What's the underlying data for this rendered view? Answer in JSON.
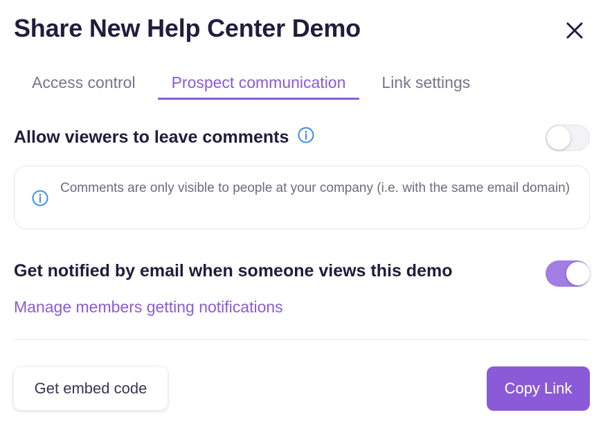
{
  "dialog": {
    "title": "Share New Help Center Demo"
  },
  "tabs": [
    {
      "label": "Access control",
      "active": false
    },
    {
      "label": "Prospect communication",
      "active": true
    },
    {
      "label": "Link settings",
      "active": false
    }
  ],
  "comments": {
    "label": "Allow viewers to leave comments",
    "enabled": false,
    "note": "Comments are only visible to people at your company (i.e. with the same email domain)"
  },
  "notifications": {
    "label": "Get notified by email when someone views this demo",
    "enabled": true,
    "manage_link": "Manage members getting notifications"
  },
  "footer": {
    "embed_label": "Get embed code",
    "copy_label": "Copy Link"
  },
  "colors": {
    "accent": "#8a5ad8",
    "toggle_on": "#a27ee4",
    "info_icon": "#3a8ee6"
  },
  "icons": {
    "close": "close-icon",
    "info": "info-icon"
  }
}
